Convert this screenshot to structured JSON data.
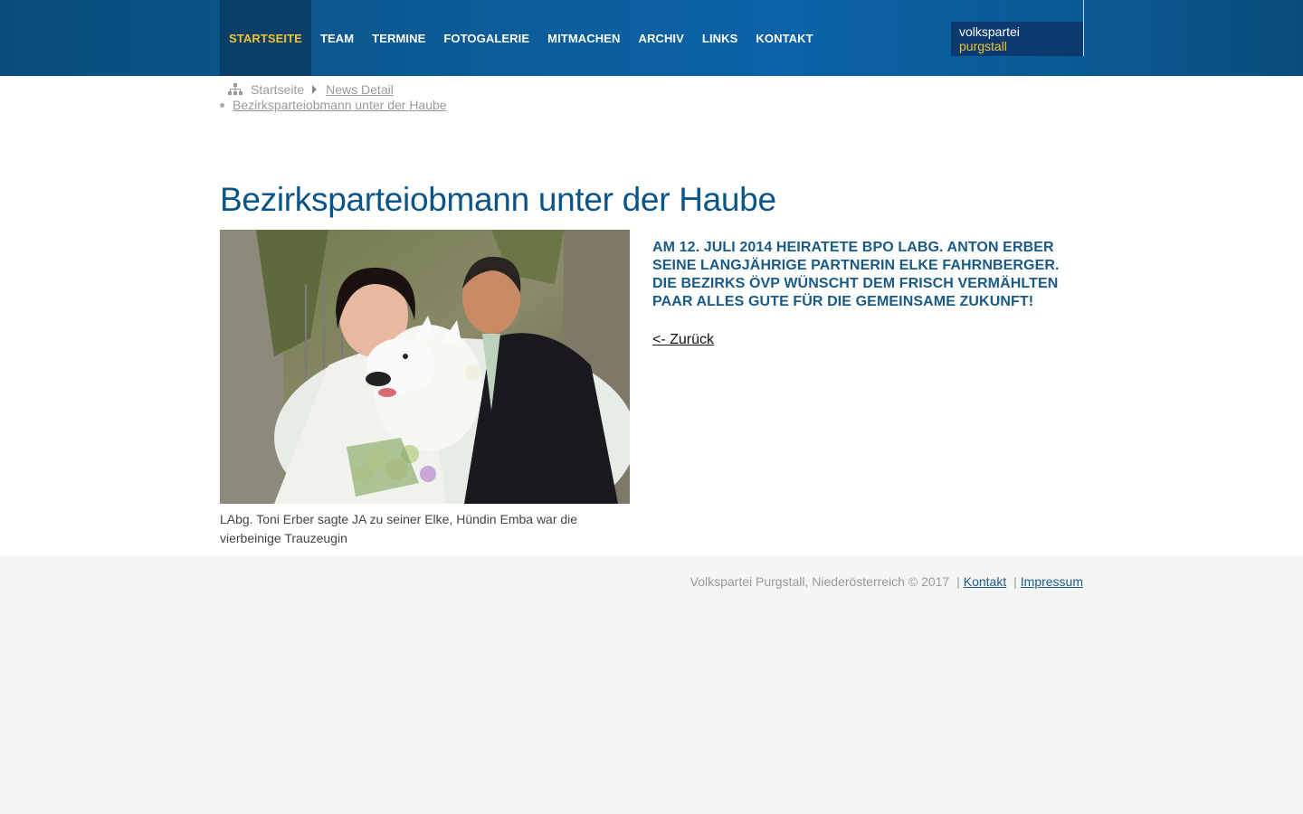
{
  "nav": {
    "items": [
      {
        "label": "Startseite",
        "active": true
      },
      {
        "label": "Team",
        "active": false
      },
      {
        "label": "Termine",
        "active": false
      },
      {
        "label": "Fotogalerie",
        "active": false
      },
      {
        "label": "Mitmachen",
        "active": false
      },
      {
        "label": "Archiv",
        "active": false
      },
      {
        "label": "Links",
        "active": false
      },
      {
        "label": "Kontakt",
        "active": false
      }
    ]
  },
  "logo": {
    "line1": "volkspartei",
    "line2": "purgstall"
  },
  "breadcrumb": {
    "home": "Startseite",
    "news_detail": "News Detail",
    "current": "Bezirksparteiobmann unter der Haube"
  },
  "article": {
    "title": "Bezirksparteiobmann unter der Haube",
    "caption": "LAbg. Toni Erber sagte JA zu seiner Elke, Hündin Emba war die vierbeinige Trauzeugin",
    "lead": "Am 12. Juli 2014 heiratete BPO LAbg. Anton Erber seine langjährige Partnerin Elke Fahrnberger. Die Bezirks ÖVP wünscht dem frisch vermählten Paar alles Gute für die gemeinsame Zukunft!",
    "back_label": "<- Zurück"
  },
  "footer": {
    "copyright": "Volkspartei Purgstall, Niederösterreich © 2017",
    "separator": "|",
    "contact_label": "Kontakt",
    "imprint_label": "Impressum"
  },
  "colors": {
    "header_blue": "#0b5b96",
    "active_nav_text": "#f2c230",
    "title_blue": "#0b5487"
  }
}
